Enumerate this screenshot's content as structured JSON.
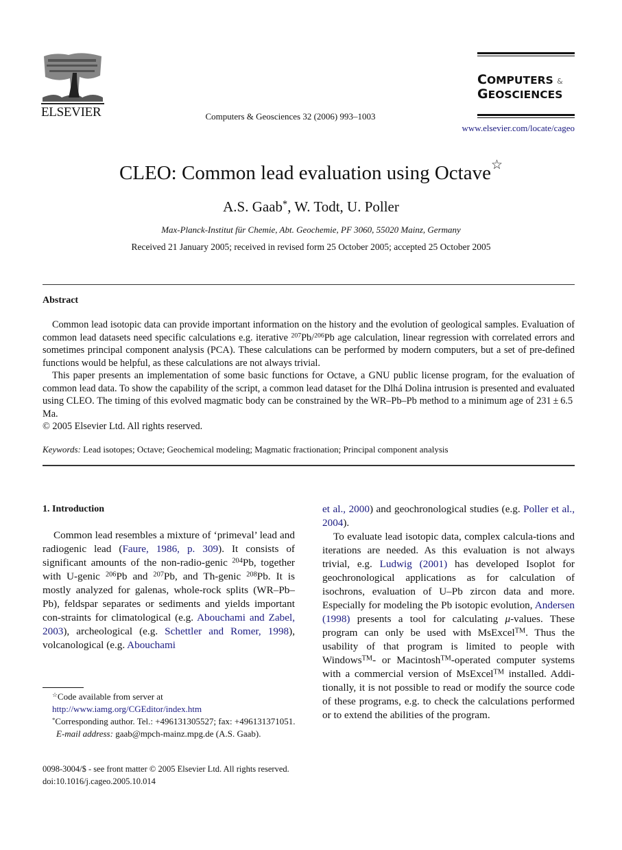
{
  "header": {
    "publisher": "ELSEVIER",
    "journal_ref": "Computers & Geosciences 32 (2006) 993–1003",
    "journal_name_line1_initial": "C",
    "journal_name_line1_rest": "OMPUTERS",
    "journal_name_amp": "&",
    "journal_name_line2_initial": "G",
    "journal_name_line2_rest": "EOSCIENCES",
    "journal_url": "www.elsevier.com/locate/cageo"
  },
  "article": {
    "title": "CLEO: Common lead evaluation using Octave",
    "title_mark": "☆",
    "authors": [
      {
        "name": "A.S. Gaab",
        "mark": "*"
      },
      {
        "name": "W. Todt",
        "mark": ""
      },
      {
        "name": "U. Poller",
        "mark": ""
      }
    ],
    "author_sep": ", ",
    "affiliation": "Max-Planck-Institut für Chemie, Abt. Geochemie, PF 3060, 55020 Mainz, Germany",
    "received": "Received 21 January 2005; received in revised form 25 October 2005; accepted 25 October 2005"
  },
  "abstract": {
    "heading": "Abstract",
    "p1": {
      "a": "Common lead isotopic data can provide important information on the history and the evolution of geological samples. Evaluation of common lead datasets need specific calculations e.g. iterative ",
      "sup1": "207",
      "b": "Pb/",
      "sup2": "206",
      "c": "Pb age calculation, linear regression with correlated errors and sometimes principal component analysis (PCA). These calculations can be performed by modern computers, but a set of pre-defined functions would be helpful, as these calculations are not always trivial."
    },
    "p2": "This paper presents an implementation of some basic functions for Octave, a GNU public license program, for the evaluation of common lead data. To show the capability of the script, a common lead dataset for the Dlhá Dolina intrusion is presented and evaluated using CLEO. The timing of this evolved magmatic body can be constrained by the WR–Pb–Pb method to a minimum age of 231 ± 6.5 Ma.",
    "copyright": "© 2005 Elsevier Ltd. All rights reserved."
  },
  "keywords": {
    "label": "Keywords:",
    "text": " Lead isotopes; Octave; Geochemical modeling; Magmatic fractionation; Principal component analysis"
  },
  "section1": {
    "heading": "1.  Introduction",
    "left": {
      "t1": "Common lead resembles a mixture of ‘primeval’ lead and radiogenic lead (",
      "l1": "Faure, 1986, p. 309",
      "t2": "). It consists of significant amounts of the non-radio-genic ",
      "s1": "204",
      "t3": "Pb, together with U-genic ",
      "s2": "206",
      "t4": "Pb and ",
      "s3": "207",
      "t5": "Pb, and Th-genic ",
      "s4": "208",
      "t6": "Pb. It is mostly analyzed for galenas, whole-rock splits (WR–Pb–Pb), feldspar separates or sediments and yields important con-straints for climatological (e.g. ",
      "l2": "Abouchami and Zabel, 2003",
      "t7": "), archeological (e.g. ",
      "l3": "Schettler and Romer, 1998",
      "t8": "), volcanological (e.g. ",
      "l4": "Abouchami"
    },
    "right": {
      "l4b": "et al., 2000",
      "t1": ") and geochronological studies (e.g. ",
      "l5": "Poller et al., 2004",
      "t2": ").",
      "p2a": "To evaluate lead isotopic data, complex calcula-tions and iterations are needed. As this evaluation is not always trivial, e.g. ",
      "l6": "Ludwig (2001)",
      "p2b": " has developed Isoplot for geochronological applications as for calculation of isochrons, evaluation of U–Pb zircon data and more. Especially for modeling the Pb isotopic evolution, ",
      "l7": "Andersen (1998)",
      "p2c": " presents a tool for calculating ",
      "mu": "μ",
      "p2d": "-values. These program can only be used with MsExcel",
      "tm": "TM",
      "p2e": ". Thus the usability of that program is limited to people with Windows",
      "p2f": "- or Macintosh",
      "p2g": "-operated computer systems with a commercial version of MsExcel",
      "p2h": " installed. Addi-tionally, it is not possible to read or modify the source code of these programs, e.g. to check the calculations performed or to extend the abilities of the program."
    }
  },
  "footnotes": {
    "star_mark": "☆",
    "code_text": "Code available from server at ",
    "code_url": "http://www.iamg.org/CGEditor/index.htm",
    "corr_mark": "*",
    "corr_text": "Corresponding author. Tel.: +496131305527; fax: +496131371051.",
    "email_label": "E-mail address:",
    "email_text": " gaab@mpch-mainz.mpg.de (A.S. Gaab)."
  },
  "footer": {
    "issn_line": "0098-3004/$ - see front matter © 2005 Elsevier Ltd. All rights reserved.",
    "doi": "doi:10.1016/j.cageo.2005.10.014"
  }
}
